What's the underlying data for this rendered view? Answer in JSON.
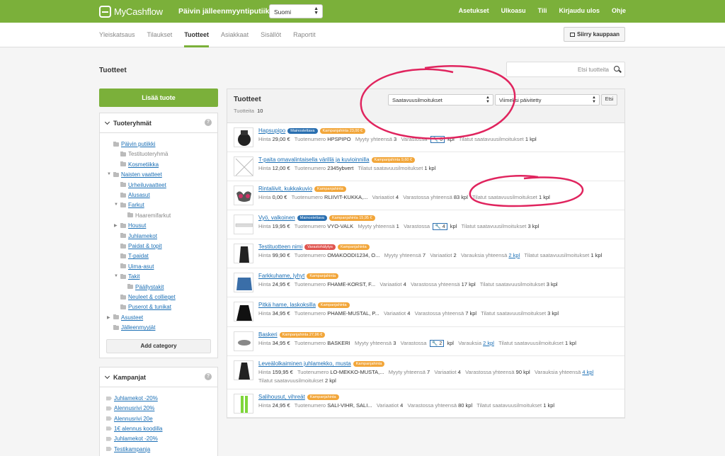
{
  "topbar": {
    "logo": "MyCashflow",
    "shop_name": "Päivin jälleenmyyntiputiikki",
    "language": "Suomi",
    "nav": [
      "Asetukset",
      "Ulkoasu",
      "Tili",
      "Kirjaudu ulos",
      "Ohje"
    ]
  },
  "subnav": {
    "items": [
      "Yleiskatsaus",
      "Tilaukset",
      "Tuotteet",
      "Asiakkaat",
      "Sisällöt",
      "Raportit"
    ],
    "active": "Tuotteet",
    "shop_button": "Siirry kauppaan"
  },
  "page": {
    "title": "Tuotteet",
    "search_placeholder": "Etsi tuotteita"
  },
  "sidebar": {
    "add_product": "Lisää tuote",
    "groups_title": "Tuoteryhmät",
    "add_category": "Add category",
    "campaigns_title": "Kampanjat",
    "tree": [
      {
        "label": "Päivin putiikki",
        "link": true
      },
      {
        "label": "Testituoteryhmä",
        "link": false
      },
      {
        "label": "Kosmetiikka",
        "link": true
      },
      {
        "label": "Naisten vaatteet",
        "link": true
      },
      {
        "label": "Urheiluvaatteet",
        "link": true
      },
      {
        "label": "Alusasut",
        "link": true
      },
      {
        "label": "Farkut",
        "link": true
      },
      {
        "label": "Haaremifarkut",
        "link": false
      },
      {
        "label": "Housut",
        "link": true
      },
      {
        "label": "Juhlamekot",
        "link": true
      },
      {
        "label": "Paidat & topit",
        "link": true
      },
      {
        "label": "T-paidat",
        "link": true
      },
      {
        "label": "Uima-asut",
        "link": true
      },
      {
        "label": "Takit",
        "link": true
      },
      {
        "label": "Päällystakit",
        "link": true
      },
      {
        "label": "Neuleet & collieget",
        "link": true
      },
      {
        "label": "Puserot & tunikat",
        "link": true
      },
      {
        "label": "Asusteet",
        "link": true
      },
      {
        "label": "Jälleenmyyjät",
        "link": true
      }
    ],
    "campaigns": [
      "Juhlamekot -20%",
      "Alennusrivi 20%",
      "Alennusrivi 20e",
      "1€ alennus koodilla",
      "Juhlamekot -20%",
      "Testikampanja"
    ]
  },
  "main": {
    "title": "Tuotteet",
    "count_label": "Tuotteita",
    "count": "10",
    "filter": "Saatavuusilmoitukset",
    "sort": "Viimeksi päivitetty",
    "search_button": "Etsi"
  },
  "products": [
    {
      "name": "Hapsupipo",
      "badges": [
        [
          "Mainostettava",
          "blue"
        ],
        [
          "Kampanjahinta 23,00 €",
          "orange"
        ]
      ],
      "meta": [
        [
          "Hinta",
          "29,00 €"
        ],
        [
          "Tuotenumero",
          "HPSPIPO"
        ],
        [
          "Myyty yhteensä",
          "3"
        ],
        [
          "Varastossa",
          "wr:6"
        ],
        [
          "Tilatut saatavuusilmoitukset",
          "1 kpl"
        ]
      ]
    },
    {
      "name": "T-paita omavalintaisella värillä ja kuvioinnilla",
      "badges": [
        [
          "Kampanjahinta 9,60 €",
          "orange"
        ]
      ],
      "meta": [
        [
          "Hinta",
          "12,00 €"
        ],
        [
          "Tuotenumero",
          "2345ybvert"
        ],
        [
          "Tilatut saatavuusilmoitukset",
          "1 kpl"
        ]
      ]
    },
    {
      "name": "Rintaliivit, kukkakuvio",
      "badges": [
        [
          "Kampanjahinta",
          "orange"
        ]
      ],
      "meta": [
        [
          "Hinta",
          "0,00 €"
        ],
        [
          "Tuotenumero",
          "RLIIVIT-KUKKA,..."
        ],
        [
          "Variaatiot",
          "4"
        ],
        [
          "Varastossa yhteensä",
          "83 kpl"
        ],
        [
          "Tilatut saatavuusilmoitukset",
          "1 kpl"
        ]
      ]
    },
    {
      "name": "Vyö, valkoinen",
      "badges": [
        [
          "Mainostettava",
          "blue"
        ],
        [
          "Kampanjahinta 15,95 €",
          "orange"
        ]
      ],
      "meta": [
        [
          "Hinta",
          "19,95 €"
        ],
        [
          "Tuotenumero",
          "VYO-VALK"
        ],
        [
          "Myyty yhteensä",
          "1"
        ],
        [
          "Varastossa",
          "wr:4"
        ],
        [
          "Tilatut saatavuusilmoitukset",
          "3 kpl"
        ]
      ]
    },
    {
      "name": "Testituotteen nimi",
      "badges": [
        [
          "Varastohälytys",
          "red"
        ],
        [
          "Kampanjahinta",
          "orange"
        ]
      ],
      "meta": [
        [
          "Hinta",
          "99,90 €"
        ],
        [
          "Tuotenumero",
          "OMAKOODI1234, O..."
        ],
        [
          "Myyty yhteensä",
          "7"
        ],
        [
          "Variaatiot",
          "2"
        ],
        [
          "Varauksia yhteensä",
          "link:2 kpl"
        ],
        [
          "Tilatut saatavuusilmoitukset",
          "1 kpl"
        ]
      ]
    },
    {
      "name": "Farkkuhame, lyhyt",
      "badges": [
        [
          "Kampanjahinta",
          "orange"
        ]
      ],
      "meta": [
        [
          "Hinta",
          "24,95 €"
        ],
        [
          "Tuotenumero",
          "FHAME-KORST, F..."
        ],
        [
          "Variaatiot",
          "4"
        ],
        [
          "Varastossa yhteensä",
          "17 kpl"
        ],
        [
          "Tilatut saatavuusilmoitukset",
          "3 kpl"
        ]
      ]
    },
    {
      "name": "Pitkä hame, laskoksilla",
      "badges": [
        [
          "Kampanjahinta",
          "orange"
        ]
      ],
      "meta": [
        [
          "Hinta",
          "34,95 €"
        ],
        [
          "Tuotenumero",
          "PHAME-MUSTAL, P..."
        ],
        [
          "Variaatiot",
          "4"
        ],
        [
          "Varastossa yhteensä",
          "7 kpl"
        ],
        [
          "Tilatut saatavuusilmoitukset",
          "3 kpl"
        ]
      ]
    },
    {
      "name": "Baskeri",
      "badges": [
        [
          "Kampanjahinta 27,96 €",
          "orange"
        ]
      ],
      "meta": [
        [
          "Hinta",
          "34,95 €"
        ],
        [
          "Tuotenumero",
          "BASKERI"
        ],
        [
          "Myyty yhteensä",
          "3"
        ],
        [
          "Varastossa",
          "wr:2"
        ],
        [
          "Varauksia",
          "link:2 kpl"
        ],
        [
          "Tilatut saatavuusilmoitukset",
          "1 kpl"
        ]
      ]
    },
    {
      "name": "Leveälolkaiminen juhlamekko, musta",
      "badges": [
        [
          "Kampanjahinta",
          "orange"
        ]
      ],
      "meta": [
        [
          "Hinta",
          "159,95 €"
        ],
        [
          "Tuotenumero",
          "LO-MEKKO-MUSTA,..."
        ],
        [
          "Myyty yhteensä",
          "7"
        ],
        [
          "Variaatiot",
          "4"
        ],
        [
          "Varastossa yhteensä",
          "90 kpl"
        ],
        [
          "Varauksia yhteensä",
          "link:4 kpl"
        ]
      ],
      "meta2": [
        [
          "Tilatut saatavuusilmoitukset",
          "2 kpl"
        ]
      ]
    },
    {
      "name": "Salihousut, vihreät",
      "badges": [
        [
          "Kampanjahinta",
          "orange"
        ]
      ],
      "meta": [
        [
          "Hinta",
          "24,95 €"
        ],
        [
          "Tuotenumero",
          "SALI-VIHR, SALI..."
        ],
        [
          "Variaatiot",
          "4"
        ],
        [
          "Varastossa yhteensä",
          "80 kpl"
        ],
        [
          "Tilatut saatavuusilmoitukset",
          "1 kpl"
        ]
      ]
    }
  ],
  "colors": {
    "brand_green": "#7bb03a",
    "annotation": "#e0245e",
    "badge_blue": "#2a6fb0",
    "badge_orange": "#f2a63a",
    "badge_red": "#e0554f"
  }
}
